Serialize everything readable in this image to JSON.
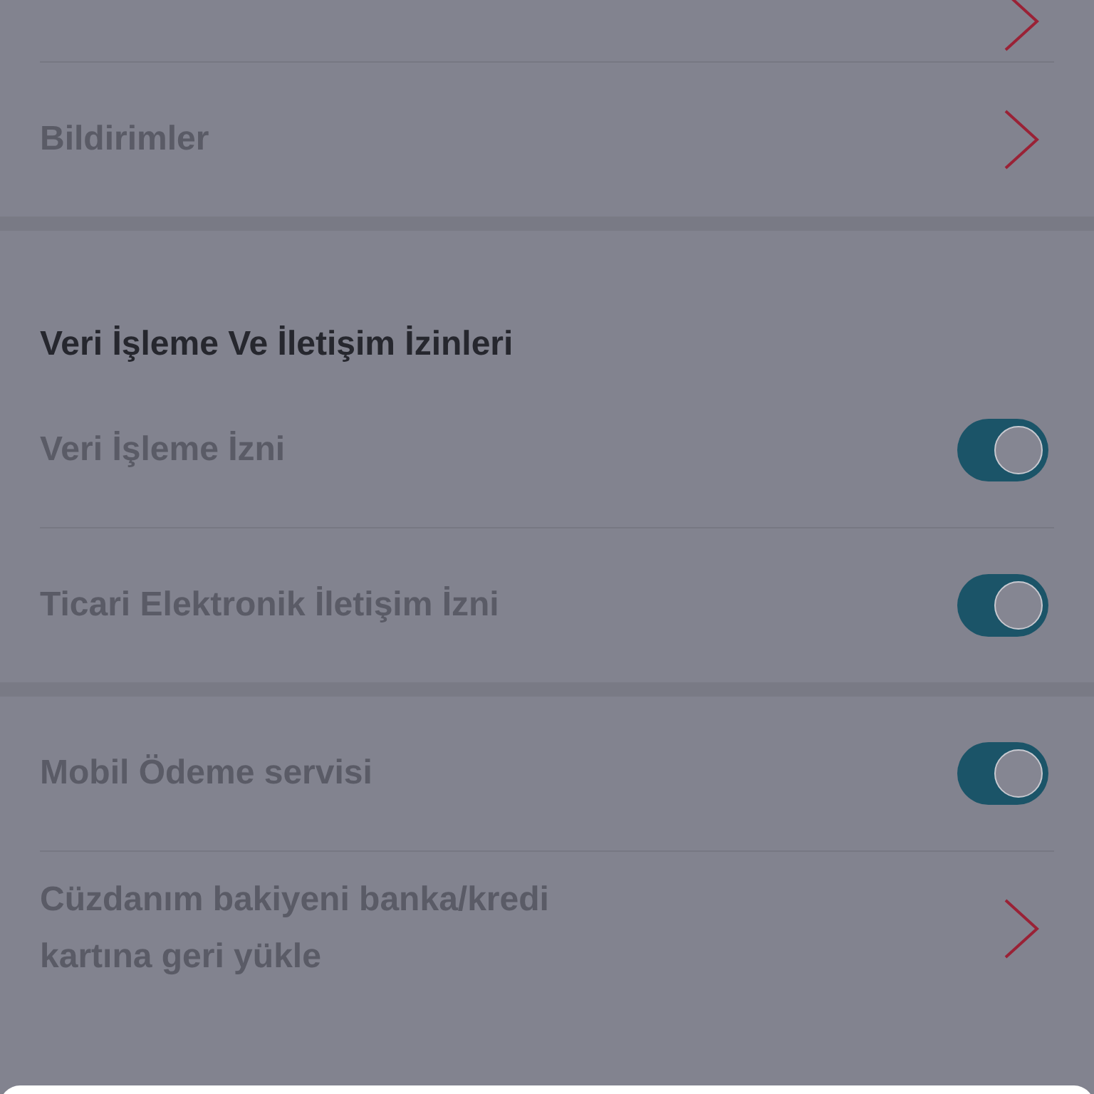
{
  "sections": [
    {
      "items": [
        {
          "kind": "link"
        },
        {
          "kind": "link",
          "label": "Bildirimler"
        }
      ]
    },
    {
      "title": "Veri İşleme Ve İletişim İzinleri",
      "items": [
        {
          "kind": "toggle",
          "label": "Veri İşleme İzni",
          "on": true
        },
        {
          "kind": "toggle",
          "label": "Ticari Elektronik İletişim İzni",
          "on": true
        }
      ]
    },
    {
      "items": [
        {
          "kind": "toggle",
          "label": "Mobil Ödeme servisi",
          "on": true
        },
        {
          "kind": "link",
          "label": "Cüzdanım bakiyeni banka/kredi kartına geri yükle"
        }
      ]
    }
  ],
  "bottom_sheet": {
    "visible": true
  }
}
